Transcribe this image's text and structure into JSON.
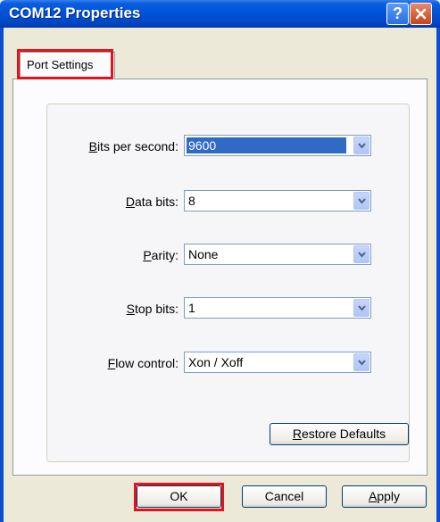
{
  "window": {
    "title": "COM12 Properties",
    "help_label": "?"
  },
  "tabs": [
    {
      "label": "Port Settings"
    }
  ],
  "fields": [
    {
      "label_key": "B",
      "label_rest": "its per second:",
      "value": "9600"
    },
    {
      "label_key": "D",
      "label_rest": "ata bits:",
      "value": "8"
    },
    {
      "label_key": "P",
      "label_rest": "arity:",
      "value": "None"
    },
    {
      "label_key": "S",
      "label_rest": "top bits:",
      "value": "1"
    },
    {
      "label_key": "F",
      "label_rest": "low control:",
      "value": "Xon / Xoff"
    }
  ],
  "buttons": {
    "restore_key": "R",
    "restore_rest": "estore Defaults",
    "ok": "OK",
    "cancel": "Cancel",
    "apply_key": "A",
    "apply_rest": "pply"
  },
  "colors": {
    "titlebar": "#0053d8",
    "highlight": "#e2131b",
    "selection": "#316ac5"
  },
  "icons": {
    "help": "help-icon",
    "close": "close-icon",
    "dropdown": "chevron-down-icon"
  }
}
